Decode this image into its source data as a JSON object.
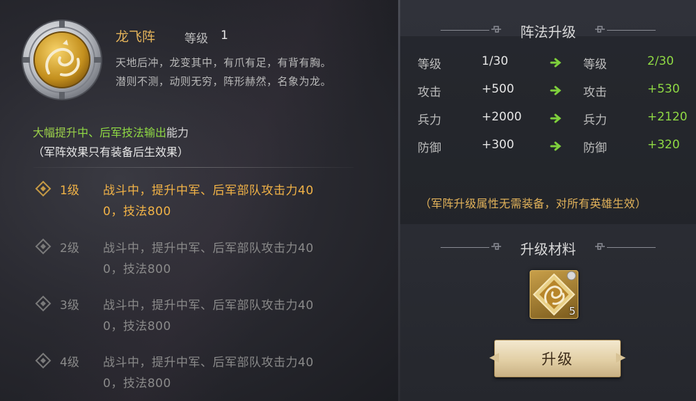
{
  "formation": {
    "name": "龙飞阵",
    "level_label": "等级",
    "level_value": "1",
    "desc_line1": "天地后冲，龙变其中，有爪有足，有背有胸。",
    "desc_line2": "潜则不测，动则无穷，阵形赫然，名象为龙。",
    "boost_prefix": "大幅提升",
    "boost_mid": "中、后军技法输出",
    "boost_suffix": "能力",
    "note": "（军阵效果只有装备后生效果）"
  },
  "tiers": [
    {
      "name": "1级",
      "line1": "战斗中，提升中军、后军部队攻击力40",
      "line2": "0，技法800"
    },
    {
      "name": "2级",
      "line1": "战斗中，提升中军、后军部队攻击力40",
      "line2": "0，技法800"
    },
    {
      "name": "3级",
      "line1": "战斗中，提升中军、后军部队攻击力40",
      "line2": "0，技法800"
    },
    {
      "name": "4级",
      "line1": "战斗中，提升中军、后军部队攻击力40",
      "line2": "0，技法800"
    }
  ],
  "upgrade": {
    "header": "阵法升级",
    "rows": [
      {
        "label": "等级",
        "current": "1/30",
        "next_label": "等级",
        "next": "2/30"
      },
      {
        "label": "攻击",
        "current": "+500",
        "next_label": "攻击",
        "next": "+530"
      },
      {
        "label": "兵力",
        "current": "+2000",
        "next_label": "兵力",
        "next": "+2120"
      },
      {
        "label": "防御",
        "current": "+300",
        "next_label": "防御",
        "next": "+320"
      }
    ],
    "note": "（军阵升级属性无需装备，对所有英雄生效）"
  },
  "materials": {
    "header": "升级材料",
    "item_count": "5",
    "item_icon": "dragon-emblem-icon"
  },
  "action": {
    "button_label": "升级"
  },
  "colors": {
    "gold": "#e2b25a",
    "green": "#8fd944",
    "orange": "#f2b347"
  }
}
